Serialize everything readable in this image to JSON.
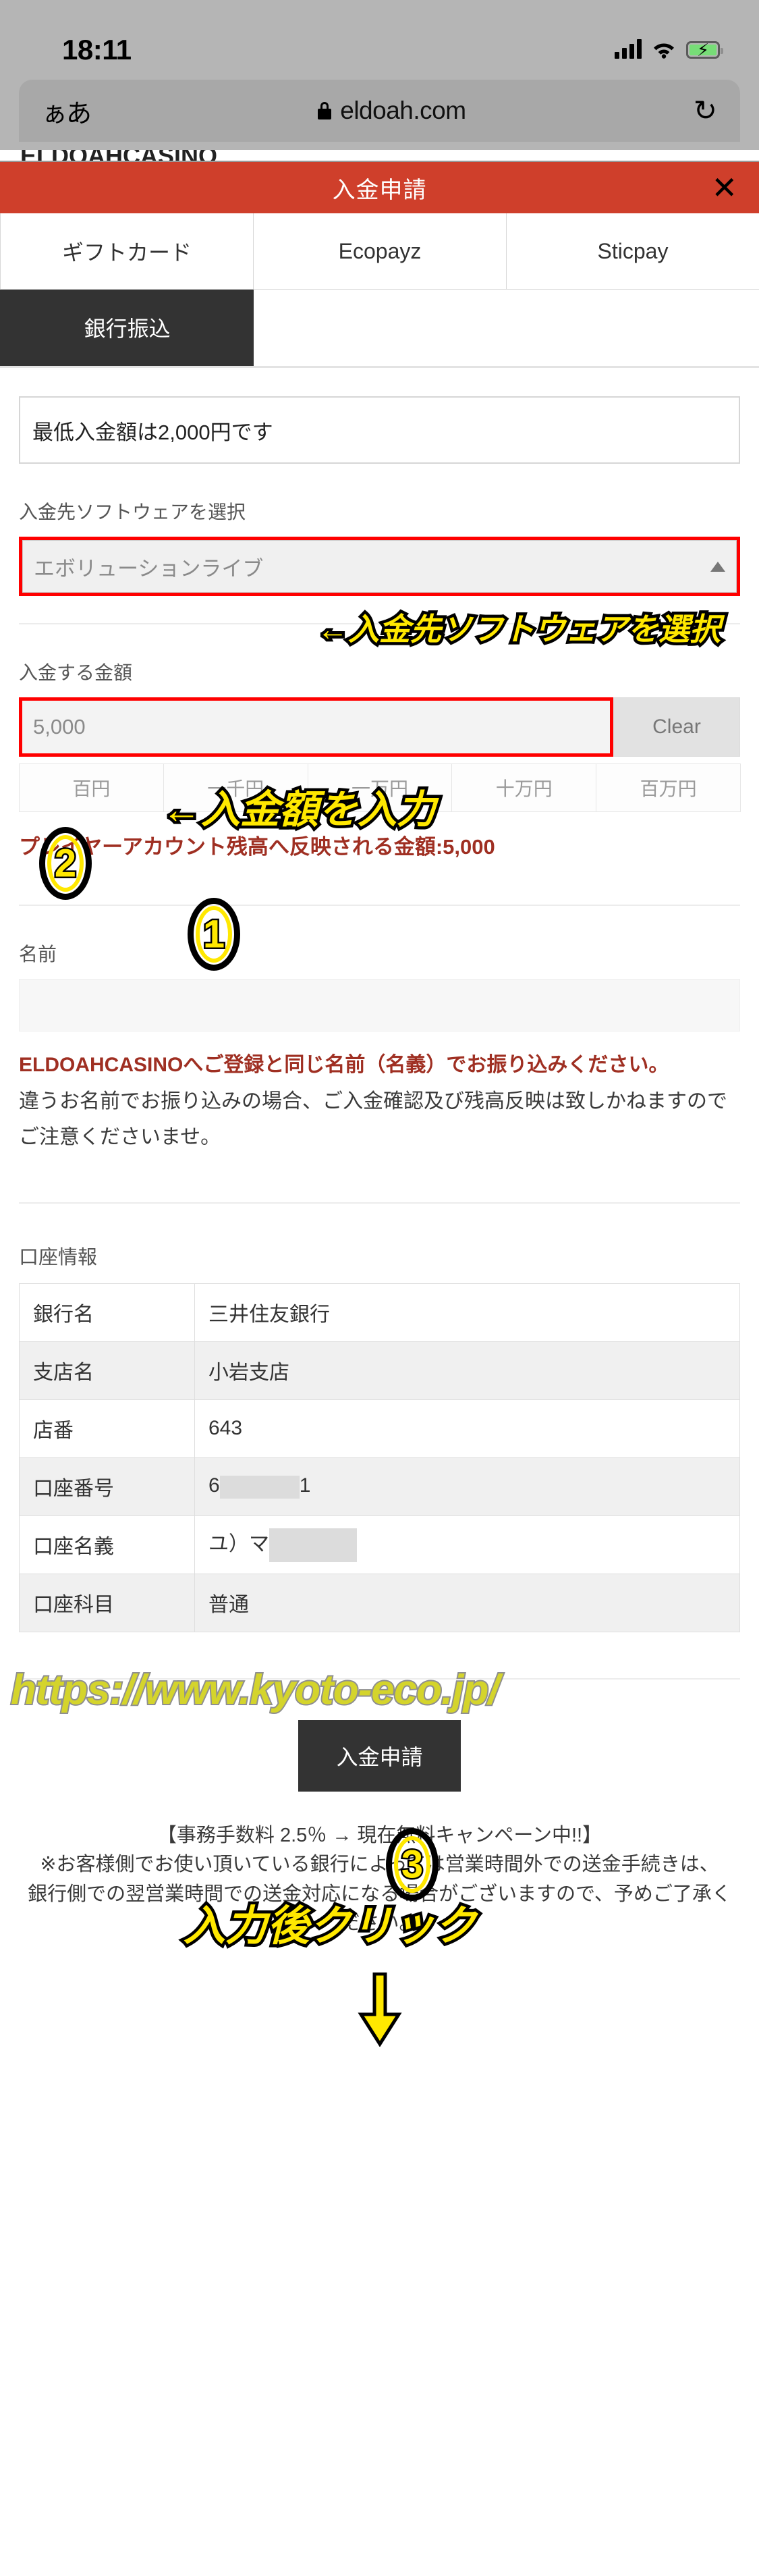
{
  "status_bar": {
    "time": "18:11",
    "signal_icon": "cellular-signal-icon",
    "wifi_icon": "wifi-icon",
    "battery_icon": "battery-charging-icon"
  },
  "browser": {
    "text_size_label": "ぁあ",
    "lock_icon": "lock-icon",
    "url": "eldoah.com",
    "reload_icon": "reload-icon"
  },
  "modal": {
    "title": "入金申請",
    "close_label": "✕",
    "clipped_page_title": "ELDOAHCASINO"
  },
  "tabs": [
    {
      "label": "ギフトカード",
      "active": false
    },
    {
      "label": "Ecopayz",
      "active": false
    },
    {
      "label": "Sticpay",
      "active": false
    },
    {
      "label": "銀行振込",
      "active": true
    }
  ],
  "form": {
    "min_deposit_notice": "最低入金額は2,000円です",
    "software_label": "入金先ソフトウェアを選択",
    "software_value": "エボリューションライブ",
    "amount_label": "入金する金額",
    "amount_value": "5,000",
    "clear_label": "Clear",
    "quick_amounts": [
      "百円",
      "一千円",
      "一万円",
      "十万円",
      "百万円"
    ],
    "reflect_text": "プレイヤーアカウント残高へ反映される金額:5,000",
    "name_label": "名前",
    "name_value": "",
    "warn_red": "ELDOAHCASINOへご登録と同じ名前（名義）でお振り込みください。",
    "warn_gray_line1": "違うお名前でお振り込みの場合、ご入金確認及び残高反映は致しかねますので",
    "warn_gray_line2": "ご注意くださいませ。"
  },
  "watermark": "https://www.kyoto-eco.jp/",
  "account": {
    "section_label": "口座情報",
    "rows": [
      {
        "key": "銀行名",
        "value": "三井住友銀行",
        "redacted": false
      },
      {
        "key": "支店名",
        "value": "小岩支店",
        "redacted": false
      },
      {
        "key": "店番",
        "value": "643",
        "redacted": false
      },
      {
        "key": "口座番号",
        "value": "6",
        "value_suffix": "1",
        "redacted": true
      },
      {
        "key": "口座名義",
        "value": "ユ）マ",
        "value_suffix": "",
        "redacted": true
      },
      {
        "key": "口座科目",
        "value": "普通",
        "redacted": false
      }
    ]
  },
  "submit": {
    "label": "入金申請"
  },
  "footer": {
    "line1": "【事務手数料 2.5％ → 現在無料キャンペーン中!!】",
    "line2": "※お客様側でお使い頂いている銀行によっては営業時間外での送金手続きは、",
    "line3": "銀行側での翌営業時間での送金対応になる場合がございますので、予めご了承ください。"
  },
  "annotations": {
    "software_arrow": "←入金先ソフトウェアを選択",
    "amount_arrow": "←入金額を入力",
    "click_after_input": "入力後クリック",
    "marker_1": "①",
    "marker_2": "②",
    "marker_3": "③"
  },
  "colors": {
    "header_red": "#cf3f2b",
    "active_tab": "#333333",
    "annotation_yellow": "#ffe800",
    "annotation_outline": "#ff0000",
    "warn_red": "#9f2f22",
    "watermark": "#d4d42c"
  }
}
